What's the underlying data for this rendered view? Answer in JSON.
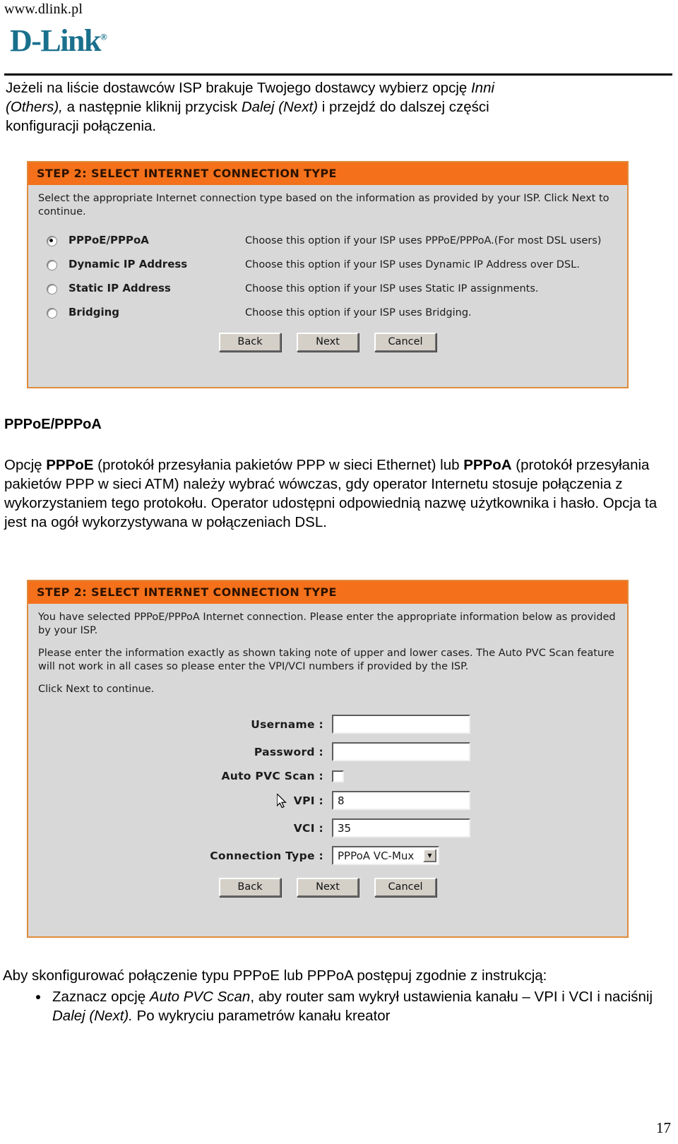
{
  "header": {
    "url": "www.dlink.pl",
    "logo_text": "D-Link",
    "logo_reg": "®",
    "logo_color": "#19708c"
  },
  "intro_paragraph": {
    "line1_a": "Jeżeli na liście dostawców ISP brakuje Twojego dostawcy wybierz opcję ",
    "line1_i": "Inni",
    "line2_i1": "(Others),",
    "line2_a": " a następnie kliknij przycisk ",
    "line2_i2": "Dalej (Next)",
    "line2_b": " i przejdź do dalszej części",
    "line3": "konfiguracji połączenia."
  },
  "section": {
    "title": "PPPoE/PPPoA",
    "p_a": "Opcję ",
    "p_b1": "PPPoE",
    "p_c": " (protokół przesyłania pakietów PPP w sieci Ethernet) lub ",
    "p_b2": "PPPoA",
    "p_d": " (protokół przesyłania pakietów PPP w sieci ATM) należy wybrać wówczas, gdy operator Internetu stosuje połączenia z wykorzystaniem tego protokołu. Operator udostępni odpowiednią nazwę użytkownika i hasło. Opcja ta jest na ogół wykorzystywana w połączeniach DSL."
  },
  "screenshot1": {
    "title": "STEP 2: SELECT INTERNET CONNECTION TYPE",
    "description": "Select the appropriate Internet connection type based on the information as provided by your ISP. Click Next to continue.",
    "options": [
      {
        "label": "PPPoE/PPPoA",
        "hint": "Choose this option if your ISP uses PPPoE/PPPoA.(For most DSL users)",
        "selected": true
      },
      {
        "label": "Dynamic IP Address",
        "hint": "Choose this option if your ISP uses Dynamic IP Address over DSL.",
        "selected": false
      },
      {
        "label": "Static IP Address",
        "hint": "Choose this option if your ISP uses Static IP assignments.",
        "selected": false
      },
      {
        "label": "Bridging",
        "hint": "Choose this option if your ISP uses Bridging.",
        "selected": false
      }
    ],
    "buttons": {
      "back": "Back",
      "next": "Next",
      "cancel": "Cancel"
    }
  },
  "screenshot2": {
    "title": "STEP 2: SELECT INTERNET CONNECTION TYPE",
    "description1": "You have selected PPPoE/PPPoA Internet connection. Please enter the appropriate information below as provided by your ISP.",
    "description2": "Please enter the information exactly as shown taking note of upper and lower cases. The Auto PVC Scan feature will not work in all cases so please enter the VPI/VCI numbers if provided by the ISP.",
    "description3": "Click Next to continue.",
    "fields": {
      "username_label": "Username :",
      "username_value": "",
      "password_label": "Password :",
      "password_value": "",
      "autopvc_label": "Auto PVC Scan :",
      "autopvc_checked": false,
      "vpi_label": "VPI :",
      "vpi_value": "8",
      "vci_label": "VCI :",
      "vci_value": "35",
      "conn_label": "Connection Type :",
      "conn_value": "PPPoA VC-Mux",
      "conn_arrow": "▼"
    },
    "buttons": {
      "back": "Back",
      "next": "Next",
      "cancel": "Cancel"
    }
  },
  "closing": {
    "lead": "Aby skonfigurować połączenie typu PPPoE lub PPPoA postępuj zgodnie z instrukcją:",
    "bullet1_a": "Zaznacz opcję ",
    "bullet1_i": "Auto PVC Scan",
    "bullet1_b": ", aby router sam wykrył ustawienia kanału – VPI i VCI i naciśnij ",
    "bullet1_i2": "Dalej (Next).",
    "bullet1_c": " Po wykryciu parametrów kanału kreator"
  },
  "page_number": "17",
  "colors": {
    "brand_orange": "#f4701a",
    "panel_border": "#e08a3c",
    "panel_bg": "#d8d8d8",
    "logo_teal": "#19708c"
  }
}
